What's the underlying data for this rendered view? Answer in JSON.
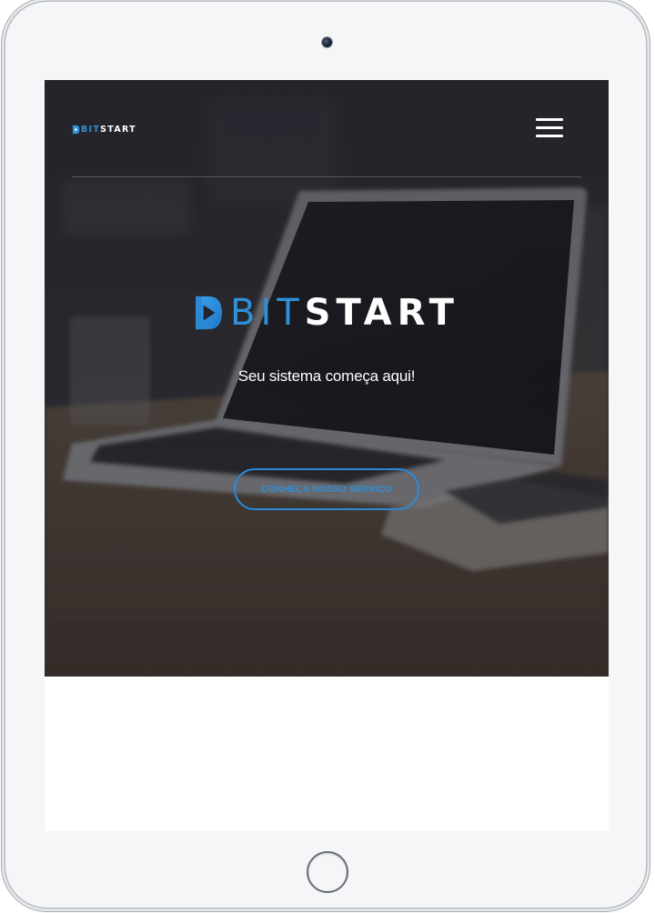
{
  "device": {
    "camera_icon": "camera-icon",
    "home_button_icon": "home-button-icon"
  },
  "navbar": {
    "logo_icon": "bitstart-play-icon",
    "logo_part1": "BIT",
    "logo_part2": "START",
    "menu_icon": "hamburger-menu-icon"
  },
  "hero": {
    "logo_icon": "bitstart-play-icon",
    "logo_part1": "BIT",
    "logo_part2": "START",
    "tagline": "Seu sistema começa aqui!",
    "cta_label": "CONHEÇA NOSSO SERVIÇO"
  },
  "colors": {
    "accent_blue": "#2f8fd8",
    "text_white": "#ffffff",
    "device_body": "#f5f6f8"
  }
}
